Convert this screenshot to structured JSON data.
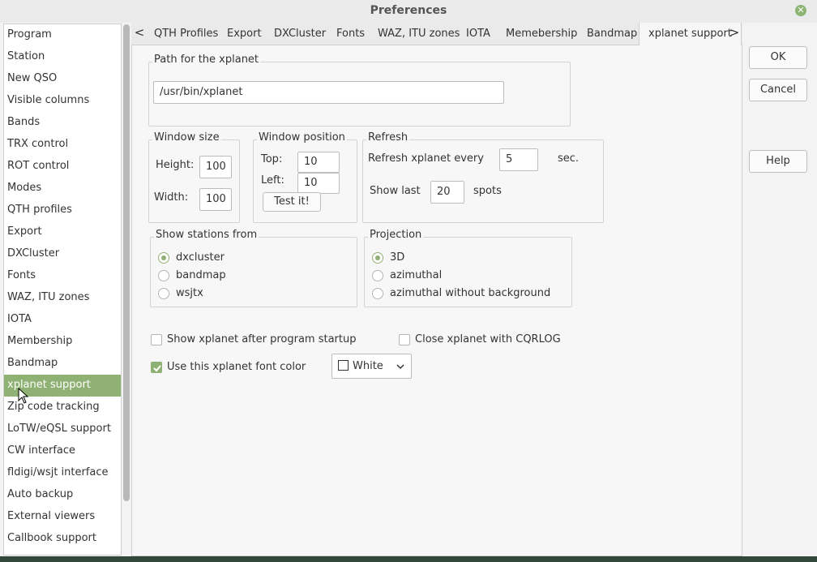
{
  "window": {
    "title": "Preferences"
  },
  "sidebar": {
    "items": [
      {
        "label": "Program"
      },
      {
        "label": "Station"
      },
      {
        "label": "New QSO"
      },
      {
        "label": "Visible columns"
      },
      {
        "label": "Bands"
      },
      {
        "label": "TRX control"
      },
      {
        "label": "ROT control"
      },
      {
        "label": "Modes"
      },
      {
        "label": "QTH profiles"
      },
      {
        "label": "Export"
      },
      {
        "label": "DXCluster"
      },
      {
        "label": "Fonts"
      },
      {
        "label": "WAZ, ITU zones"
      },
      {
        "label": "IOTA"
      },
      {
        "label": "Membership"
      },
      {
        "label": "Bandmap"
      },
      {
        "label": "xplanet support",
        "active": true
      },
      {
        "label": "Zip code tracking"
      },
      {
        "label": "LoTW/eQSL support"
      },
      {
        "label": "CW interface"
      },
      {
        "label": "fldigi/wsjt interface"
      },
      {
        "label": "Auto backup"
      },
      {
        "label": "External viewers"
      },
      {
        "label": "Callbook support"
      }
    ]
  },
  "tabs": {
    "left_arrow": "<",
    "right_arrow": ">",
    "items": [
      "QTH Profiles",
      "Export",
      "DXCluster",
      "Fonts",
      "WAZ, ITU zones",
      "IOTA",
      "Memebership",
      "Bandmap",
      "xplanet support"
    ],
    "active": "xplanet support"
  },
  "xplanet": {
    "path_group": "Path for the xplanet",
    "path_value": "/usr/bin/xplanet",
    "window_size": {
      "title": "Window size",
      "height_label": "Height:",
      "height_value": "100",
      "width_label": "Width:",
      "width_value": "100"
    },
    "window_position": {
      "title": "Window position",
      "top_label": "Top:",
      "top_value": "10",
      "left_label": "Left:",
      "left_value": "10",
      "test_button": "Test it!"
    },
    "refresh": {
      "title": "Refresh",
      "every_label": "Refresh xplanet every",
      "every_value": "5",
      "every_unit": "sec.",
      "show_last_label": "Show last",
      "show_last_value": "20",
      "show_last_unit": "spots"
    },
    "show_stations": {
      "title": "Show stations from",
      "options": [
        "dxcluster",
        "bandmap",
        "wsjtx"
      ],
      "selected": "dxcluster"
    },
    "projection": {
      "title": "Projection",
      "options": [
        "3D",
        "azimuthal",
        "azimuthal without background"
      ],
      "selected": "3D"
    },
    "show_after_startup": {
      "label": "Show xplanet after program startup",
      "checked": false
    },
    "close_with_cqrlog": {
      "label": "Close xplanet with CQRLOG",
      "checked": false
    },
    "use_font_color": {
      "label": "Use this xplanet font color",
      "checked": true
    },
    "font_color": {
      "value": "White",
      "swatch": "#ffffff"
    }
  },
  "buttons": {
    "ok": "OK",
    "cancel": "Cancel",
    "help": "Help"
  },
  "colors": {
    "accent": "#8fb173",
    "close": "#8ab572"
  }
}
